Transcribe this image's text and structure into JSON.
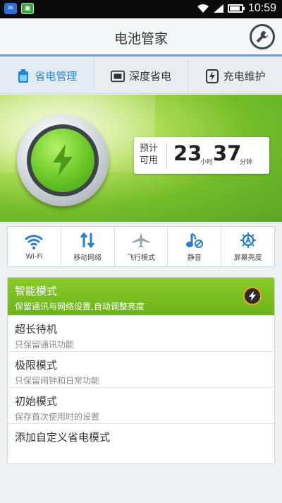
{
  "status_bar": {
    "time": "10:59"
  },
  "header": {
    "title": "电池管家"
  },
  "tabs": [
    {
      "label": "省电管理",
      "active": true
    },
    {
      "label": "深度省电",
      "active": false
    },
    {
      "label": "充电维护",
      "active": false
    }
  ],
  "estimate": {
    "label_line1": "预计",
    "label_line2": "可用",
    "hours": "23",
    "hours_unit": "小时",
    "minutes": "37",
    "minutes_unit": "分钟"
  },
  "toggles": [
    {
      "label": "Wi-Fi",
      "icon": "wifi-icon"
    },
    {
      "label": "移动网络",
      "icon": "mobile-data-icon"
    },
    {
      "label": "飞行模式",
      "icon": "airplane-icon"
    },
    {
      "label": "静音",
      "icon": "mute-icon"
    },
    {
      "label": "屏幕亮度",
      "icon": "brightness-icon"
    }
  ],
  "modes": [
    {
      "title": "智能模式",
      "desc": "保留通讯与网络设置,自动调整亮度",
      "active": true
    },
    {
      "title": "超长待机",
      "desc": "只保留通讯功能"
    },
    {
      "title": "极限模式",
      "desc": "只保留闹钟和日常功能"
    },
    {
      "title": "初始模式",
      "desc": "保存首次使用时的设置"
    },
    {
      "title": "添加自定义省电模式"
    }
  ],
  "colors": {
    "accent": "#1f88d6",
    "active_green": "#7ec022",
    "header_line": "#5aa6dc"
  }
}
